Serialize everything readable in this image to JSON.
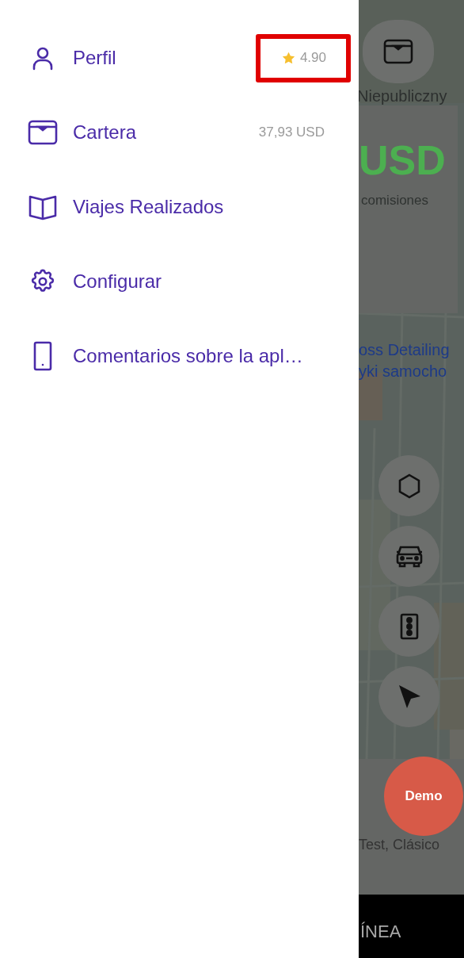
{
  "drawer": {
    "items": [
      {
        "label": "Perfil",
        "kind": "person",
        "badge": {
          "kind": "rating",
          "text": "4.90",
          "highlighted": true
        }
      },
      {
        "label": "Cartera",
        "kind": "wallet",
        "badge": {
          "kind": "amount",
          "text": "37,93 USD",
          "highlighted": false
        }
      },
      {
        "label": "Viajes Realizados",
        "kind": "book"
      },
      {
        "label": "Configurar",
        "kind": "gear"
      },
      {
        "label": "Comentarios sobre la apl…",
        "kind": "phone"
      }
    ]
  },
  "place_label": "Niepubliczny",
  "balance": {
    "amount": "USD",
    "caption": "comisiones"
  },
  "map_labels": [
    "oss Detailing",
    "yki samocho"
  ],
  "map_buttons": [
    {
      "kind": "hexagon"
    },
    {
      "kind": "car"
    },
    {
      "kind": "traffic-light"
    },
    {
      "kind": "navigation"
    }
  ],
  "demo_button": "Demo",
  "vehicle_info": "Test, Clásico",
  "status_bar": "ÍNEA"
}
